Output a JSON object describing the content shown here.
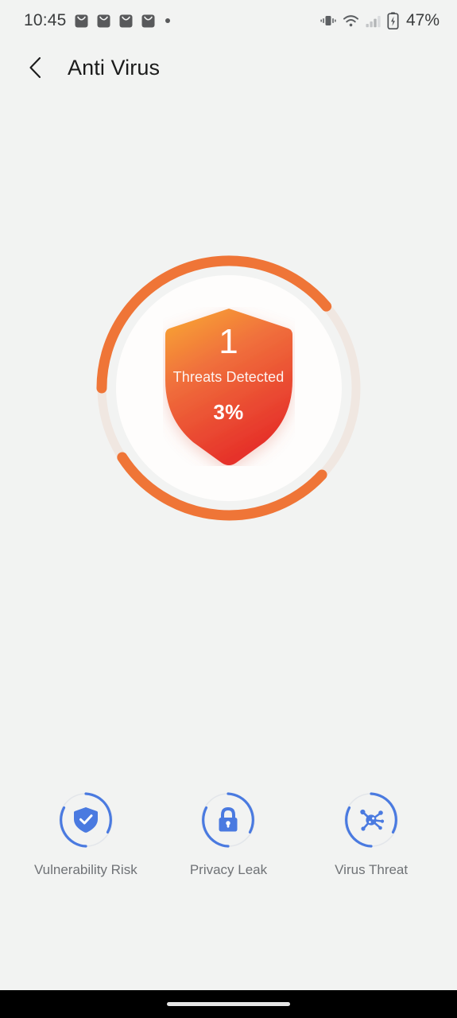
{
  "status_bar": {
    "clock": "10:45",
    "notification_icons": [
      "mail-icon",
      "mail-icon",
      "mail-icon",
      "mail-icon",
      "dot-badge-icon"
    ],
    "right_icons": [
      "vibrate-icon",
      "wifi-icon",
      "signal-bars-icon",
      "battery-charging-icon"
    ],
    "battery_percent": "47%",
    "text_color": "#3a3c3d"
  },
  "app_bar": {
    "back_icon": "chevron-left-icon",
    "title": "Anti Virus"
  },
  "scan": {
    "threat_count": "1",
    "threat_label": "Threats Detected",
    "percent": "3%",
    "ring_track_color": "#f0e7e1",
    "ring_arc_color": "#ef7537",
    "shield_gradient_start": "#f8a836",
    "shield_gradient_mid": "#ef6a3c",
    "shield_gradient_end": "#e8372c",
    "arcs": [
      {
        "start_deg": 200,
        "end_deg": 20
      },
      {
        "start_deg": 38,
        "end_deg": 160
      }
    ]
  },
  "categories": [
    {
      "label": "Vulnerability Risk",
      "icon": "shield-check-icon",
      "accent": "#4a7ae0"
    },
    {
      "label": "Privacy Leak",
      "icon": "lock-icon",
      "accent": "#4a7ae0"
    },
    {
      "label": "Virus Threat",
      "icon": "virus-icon",
      "accent": "#4a7ae0"
    }
  ],
  "nav_bar": {
    "gesture_pill": "home-indicator"
  },
  "theme": {
    "background": "#f2f3f2",
    "accent_orange": "#ef7537",
    "accent_blue": "#4a7ae0",
    "label_grey": "#6f7276"
  }
}
